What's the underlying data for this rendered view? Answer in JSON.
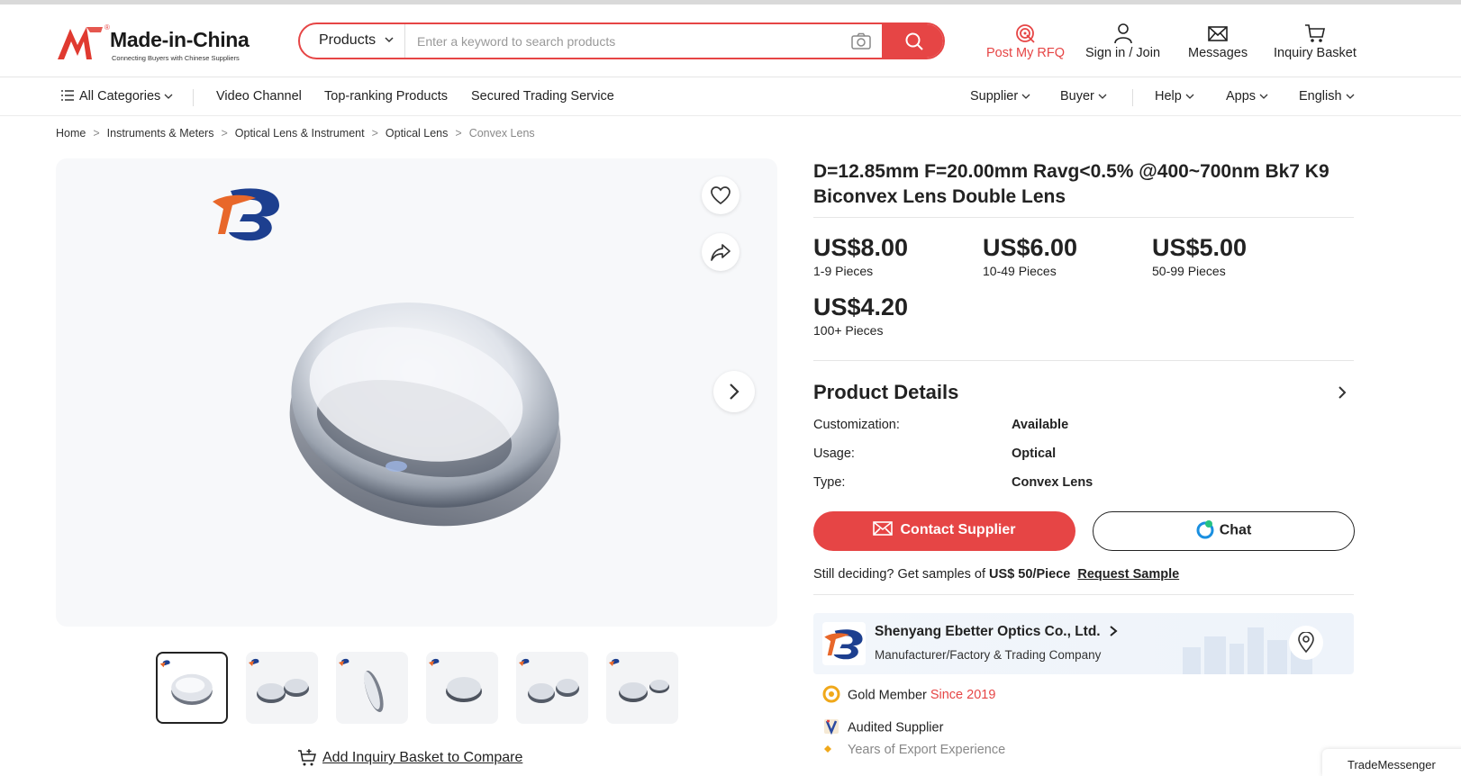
{
  "header": {
    "logo_name": "Made-in-China",
    "logo_tagline": "Connecting Buyers with Chinese Suppliers",
    "search_category": "Products",
    "search_placeholder": "Enter a keyword to search products",
    "post_rfq": "Post My RFQ",
    "sign_in": "Sign in / Join",
    "messages": "Messages",
    "inquiry_basket": "Inquiry Basket"
  },
  "nav": {
    "all_categories": "All Categories",
    "video_channel": "Video Channel",
    "top_ranking": "Top-ranking Products",
    "secured_trading": "Secured Trading Service",
    "supplier": "Supplier",
    "buyer": "Buyer",
    "help": "Help",
    "apps": "Apps",
    "language": "English"
  },
  "breadcrumb": [
    "Home",
    "Instruments & Meters",
    "Optical Lens & Instrument",
    "Optical Lens",
    "Convex Lens"
  ],
  "product": {
    "title": "D=12.85mm F=20.00mm Ravg<0.5% @400~700nm Bk7 K9 Biconvex Lens Double Lens",
    "prices": [
      {
        "amount": "US$8.00",
        "qty": "1-9 Pieces"
      },
      {
        "amount": "US$6.00",
        "qty": "10-49 Pieces"
      },
      {
        "amount": "US$5.00",
        "qty": "50-99 Pieces"
      },
      {
        "amount": "US$4.20",
        "qty": "100+ Pieces"
      }
    ],
    "details_title": "Product Details",
    "attributes": [
      {
        "label": "Customization:",
        "value": "Available"
      },
      {
        "label": "Usage:",
        "value": "Optical"
      },
      {
        "label": "Type:",
        "value": "Convex Lens"
      }
    ],
    "contact_label": "Contact Supplier",
    "chat_label": "Chat",
    "sample_text": "Still deciding? Get samples of",
    "sample_price": "US$ 50/Piece",
    "sample_link": "Request Sample",
    "compare_label": "Add Inquiry Basket to Compare"
  },
  "supplier": {
    "name": "Shenyang Ebetter Optics Co., Ltd.",
    "type": "Manufacturer/Factory & Trading Company",
    "gold_member": "Gold Member",
    "since": "Since 2019",
    "audited": "Audited Supplier",
    "export_exp": "Years of Export Experience"
  },
  "trade_messenger": "TradeMessenger",
  "colors": {
    "accent": "#e64545",
    "text": "#222222",
    "muted": "#888888"
  }
}
